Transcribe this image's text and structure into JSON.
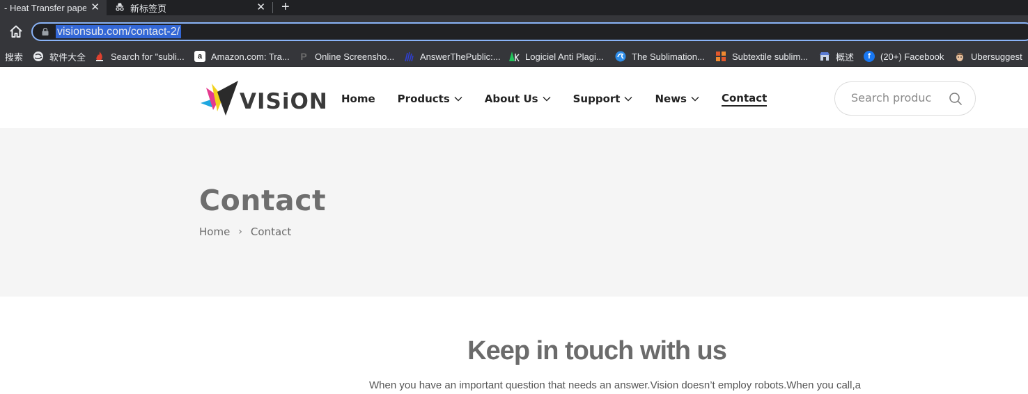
{
  "browser": {
    "tabs": [
      {
        "title": "- Heat Transfer paper(",
        "active": true
      },
      {
        "title": "新标签页",
        "active": false
      }
    ],
    "new_tab_label": "+",
    "close_glyph": "✕",
    "url": "visionsub.com/contact-2/",
    "bookmarks": [
      {
        "label": "搜索",
        "icon": ""
      },
      {
        "label": "软件大全",
        "icon": "globe-icon"
      },
      {
        "label": "Search for \"subli...",
        "icon": "flame-icon"
      },
      {
        "label": "Amazon.com: Tra...",
        "icon": "amazon-icon"
      },
      {
        "label": "Online Screensho...",
        "icon": "p-icon"
      },
      {
        "label": "AnswerThePublic:...",
        "icon": "hand-icon"
      },
      {
        "label": "Logiciel Anti Plagi...",
        "icon": "dk-icon"
      },
      {
        "label": "The Sublimation...",
        "icon": "swirl-icon"
      },
      {
        "label": "Subtextile sublim...",
        "icon": "grid-icon"
      },
      {
        "label": "概述",
        "icon": "store-icon"
      },
      {
        "label": "(20+) Facebook",
        "icon": "facebook-icon"
      },
      {
        "label": "Ubersuggest",
        "icon": "face-icon"
      }
    ]
  },
  "site": {
    "logo_text": "VISiON",
    "nav": [
      {
        "label": "Home",
        "has_dropdown": false,
        "current": false
      },
      {
        "label": "Products",
        "has_dropdown": true,
        "current": false
      },
      {
        "label": "About Us",
        "has_dropdown": true,
        "current": false
      },
      {
        "label": "Support",
        "has_dropdown": true,
        "current": false
      },
      {
        "label": "News",
        "has_dropdown": true,
        "current": false
      },
      {
        "label": "Contact",
        "has_dropdown": false,
        "current": true
      }
    ],
    "search_placeholder": "Search products"
  },
  "banner": {
    "title": "Contact",
    "breadcrumb": [
      "Home",
      "Contact"
    ],
    "breadcrumb_separator": "›"
  },
  "content": {
    "heading": "Keep in touch with us",
    "intro": "When you have an important question that needs an answer.Vision doesn’t employ robots.When you call,a"
  },
  "colors": {
    "chrome_dark": "#202124",
    "chrome_toolbar": "#35363a",
    "omnibox_focus": "#8ab4f8",
    "url_selection": "#3367d6",
    "banner_bg": "#f5f5f5",
    "title_gray": "#6e6e6e"
  }
}
